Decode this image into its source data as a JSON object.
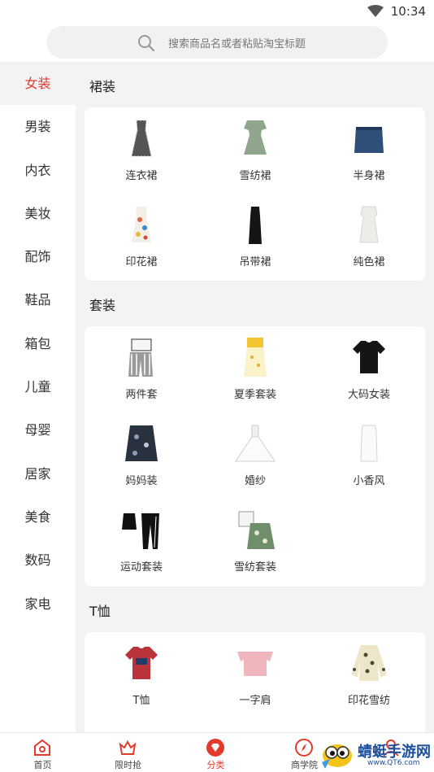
{
  "status": {
    "time": "10:34"
  },
  "search": {
    "placeholder": "搜索商品名或者粘贴淘宝标题"
  },
  "sidebar": {
    "items": [
      "女装",
      "男装",
      "内衣",
      "美妆",
      "配饰",
      "鞋品",
      "箱包",
      "儿童",
      "母婴",
      "居家",
      "美食",
      "数码",
      "家电"
    ],
    "active": "女装"
  },
  "sections": [
    {
      "title": "裙装",
      "items": [
        "连衣裙",
        "雪纺裙",
        "半身裙",
        "印花裙",
        "吊带裙",
        "纯色裙"
      ]
    },
    {
      "title": "套装",
      "items": [
        "两件套",
        "夏季套装",
        "大码女装",
        "妈妈装",
        "婚纱",
        "小香风",
        "运动套装",
        "雪纺套装"
      ]
    },
    {
      "title": "T恤",
      "items": [
        "T恤",
        "一字肩",
        "印花雪纺"
      ]
    }
  ],
  "tabbar": {
    "items": [
      {
        "label": "首页",
        "icon": "home-icon"
      },
      {
        "label": "限时抢",
        "icon": "crown-icon"
      },
      {
        "label": "分类",
        "icon": "diamond-icon"
      },
      {
        "label": "商学院",
        "icon": "compass-icon"
      },
      {
        "label": "",
        "icon": "user-icon"
      }
    ],
    "active": "分类"
  },
  "watermark": {
    "text": "蜻蜓手游网",
    "sub": "www.QT6.com"
  },
  "colors": {
    "accent": "#e23b2e",
    "brand_watermark": "#1b4f9c"
  }
}
